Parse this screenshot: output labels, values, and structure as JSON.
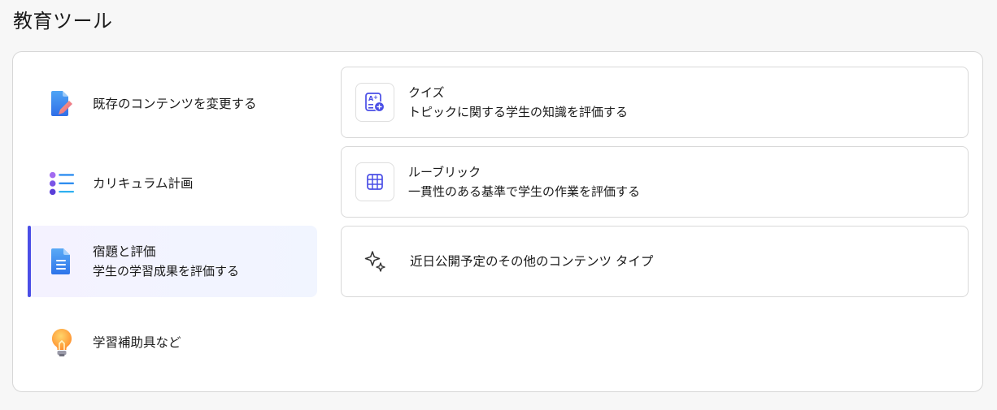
{
  "page": {
    "title": "教育ツール"
  },
  "nav": {
    "items": [
      {
        "label": "既存のコンテンツを変更する",
        "sub": "",
        "icon": "edit-document-icon"
      },
      {
        "label": "カリキュラム計画",
        "sub": "",
        "icon": "list-icon"
      },
      {
        "label": "宿題と評価",
        "sub": "学生の学習成果を評価する",
        "icon": "document-icon",
        "active": true
      },
      {
        "label": "学習補助具など",
        "sub": "",
        "icon": "lightbulb-icon"
      }
    ]
  },
  "cards": [
    {
      "title": "クイズ",
      "desc": "トピックに関する学生の知識を評価する",
      "icon": "quiz-icon"
    },
    {
      "title": "ルーブリック",
      "desc": "一貫性のある基準で学生の作業を評価する",
      "icon": "table-grid-icon"
    },
    {
      "title": "近日公開予定のその他のコンテンツ タイプ",
      "desc": "",
      "icon": "sparkle-icon"
    }
  ],
  "colors": {
    "accent": "#4a4ee6",
    "active_bg": "#f3f3ff"
  }
}
